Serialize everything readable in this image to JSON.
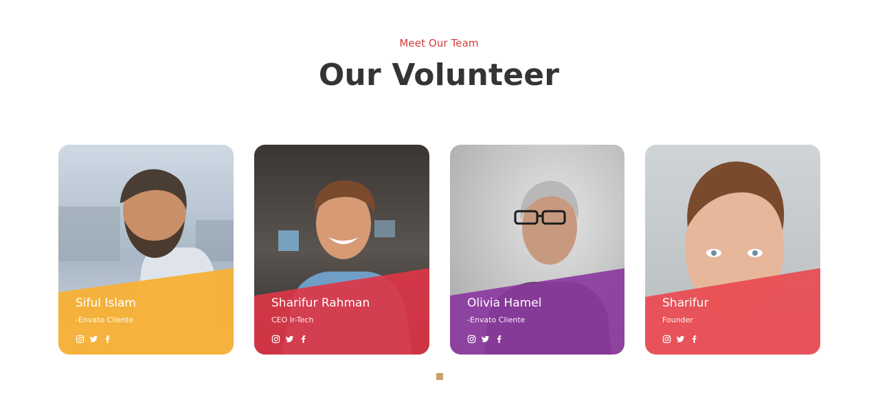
{
  "section": {
    "eyebrow": "Meet Our Team",
    "title": "Our Volunteer"
  },
  "colors": {
    "eyebrow": "#d23a3a",
    "title": "#343434",
    "pagination_dot": "#c9a06b"
  },
  "cards": [
    {
      "name": "Siful Islam",
      "role": "-Envato Cliente",
      "accent": "#f7b035",
      "socials": [
        "instagram-icon",
        "twitter-icon",
        "facebook-icon"
      ]
    },
    {
      "name": "Sharifur Rahman",
      "role": "CEO Ir-Tech",
      "accent": "#dc3646",
      "socials": [
        "instagram-icon",
        "twitter-icon",
        "facebook-icon"
      ]
    },
    {
      "name": "Olivia Hamel",
      "role": "-Envato Cliente",
      "accent": "#8c3aa0",
      "socials": [
        "instagram-icon",
        "twitter-icon",
        "facebook-icon"
      ]
    },
    {
      "name": "Sharifur",
      "role": "Founder",
      "accent": "#ea4a50",
      "socials": [
        "instagram-icon",
        "twitter-icon",
        "facebook-icon"
      ]
    }
  ],
  "pagination": {
    "pages": 1,
    "active": 1
  }
}
